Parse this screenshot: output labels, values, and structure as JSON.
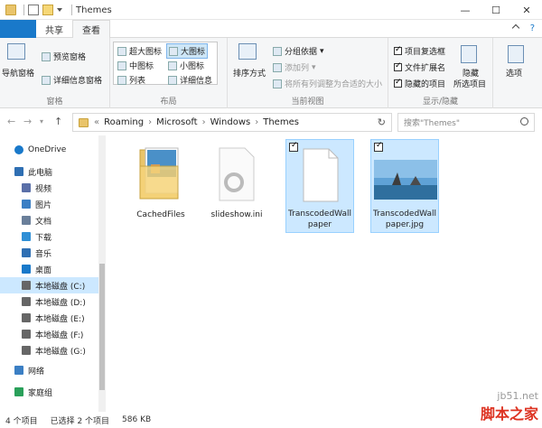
{
  "window": {
    "title": "Themes",
    "minimize": "—",
    "maximize": "☐",
    "close": "✕"
  },
  "ribbon_tabs": [
    "文件",
    "主页",
    "共享",
    "查看"
  ],
  "help_label": "?",
  "ribbon": {
    "panes": {
      "nav_pane": "导航窗格",
      "preview_pane": "预览窗格",
      "details_pane": "详细信息窗格",
      "label": "窗格"
    },
    "layout": {
      "extra_large": "超大图标",
      "large": "大图标",
      "medium": "中图标",
      "small": "小图标",
      "list": "列表",
      "details": "详细信息",
      "label": "布局"
    },
    "current_view": {
      "sort_by": "排序方式",
      "group_by": "分组依据",
      "add_column": "添加列",
      "size_all_columns": "将所有列调整为合适的大小",
      "label": "当前视图"
    },
    "show_hide": {
      "item_checkboxes": "项目复选框",
      "file_extensions": "文件扩展名",
      "hidden_items": "隐藏的项目",
      "hide_selected": "隐藏",
      "hide_selected_line2": "所选项目",
      "label": "显示/隐藏",
      "options": "选项"
    }
  },
  "address": {
    "prefix": "«",
    "crumbs": [
      "Roaming",
      "Microsoft",
      "Windows",
      "Themes"
    ],
    "search_placeholder": "搜索\"Themes\""
  },
  "nav_pane": {
    "items": [
      {
        "label": "OneDrive"
      },
      {
        "label": "此电脑"
      },
      {
        "label": "视频"
      },
      {
        "label": "图片"
      },
      {
        "label": "文档"
      },
      {
        "label": "下载"
      },
      {
        "label": "音乐"
      },
      {
        "label": "桌面"
      },
      {
        "label": "本地磁盘 (C:)"
      },
      {
        "label": "本地磁盘 (D:)"
      },
      {
        "label": "本地磁盘 (E:)"
      },
      {
        "label": "本地磁盘 (F:)"
      },
      {
        "label": "本地磁盘 (G:)"
      },
      {
        "label": "网络"
      },
      {
        "label": "家庭组"
      }
    ]
  },
  "files": [
    {
      "name": "CachedFiles"
    },
    {
      "name": "slideshow.ini"
    },
    {
      "name": "TranscodedWallpaper"
    },
    {
      "name": "TranscodedWallpaper.jpg"
    }
  ],
  "status": {
    "count": "4 个项目",
    "selected": "已选择 2 个项目",
    "size": "586 KB"
  },
  "watermark": {
    "site": "jb51.net",
    "brand": "脚本之家"
  },
  "colors": {
    "accent": "#1979ca",
    "selection": "#cce8ff",
    "folder": "#e9c46a"
  }
}
